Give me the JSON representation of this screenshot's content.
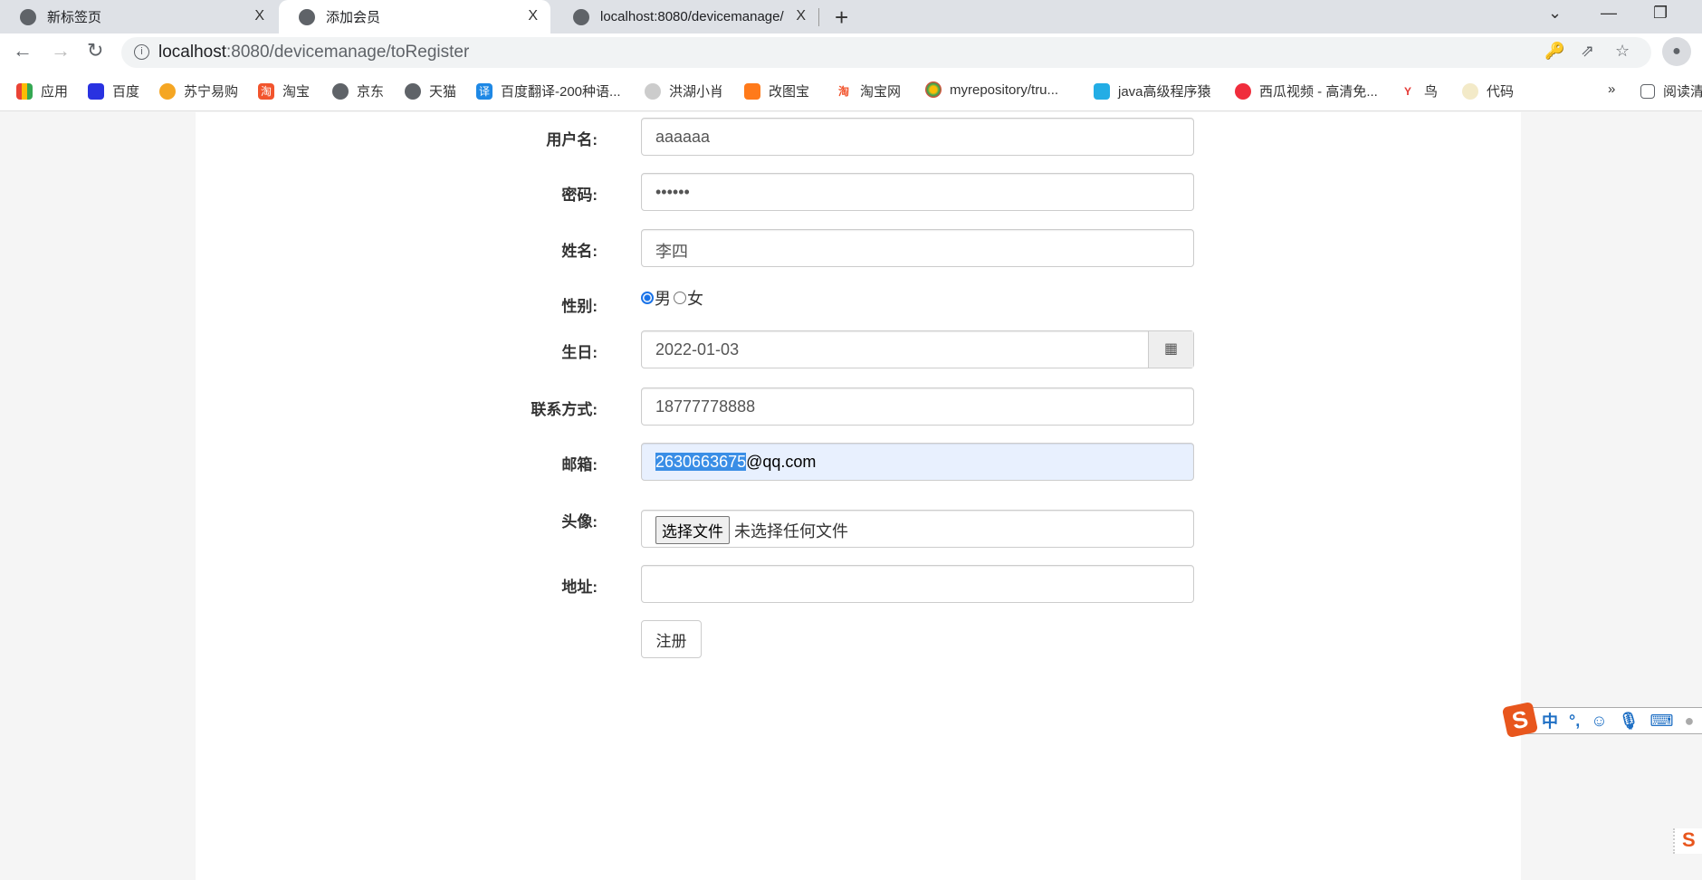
{
  "browser": {
    "tabs": [
      {
        "title": "新标签页",
        "active": false
      },
      {
        "title": "添加会员",
        "active": true
      },
      {
        "title": "localhost:8080/devicemanage/",
        "active": false
      }
    ],
    "close_glyph": "X",
    "new_tab": "+",
    "url_host": "localhost",
    "url_rest": ":8080/devicemanage/toRegister",
    "bookmarks": [
      "应用",
      "百度",
      "苏宁易购",
      "淘宝",
      "京东",
      "天猫",
      "百度翻译-200种语...",
      "洪湖小肖",
      "改图宝",
      "淘宝网",
      "myrepository/tru...",
      "java高级程序猿",
      "西瓜视频 - 高清免...",
      "鸟",
      "代码"
    ],
    "overflow": "»",
    "reading_list": "阅读清"
  },
  "form": {
    "username_label": "用户名:",
    "username_value": "aaaaaa",
    "password_label": "密码:",
    "password_value": "••••••",
    "name_label": "姓名:",
    "name_value": "李四",
    "gender_label": "性别:",
    "gender_options": [
      "男",
      "女"
    ],
    "gender_selected": "男",
    "birthday_label": "生日:",
    "birthday_value": "2022-01-03",
    "phone_label": "联系方式:",
    "phone_value": "18777778888",
    "email_label": "邮箱:",
    "email_selected": "2630663675",
    "email_rest": "@qq.com",
    "avatar_label": "头像:",
    "file_button": "选择文件",
    "file_status": "未选择任何文件",
    "address_label": "地址:",
    "address_value": "",
    "submit": "注册"
  },
  "ime": {
    "logo": "S",
    "mode": "中",
    "punct": "°,"
  }
}
